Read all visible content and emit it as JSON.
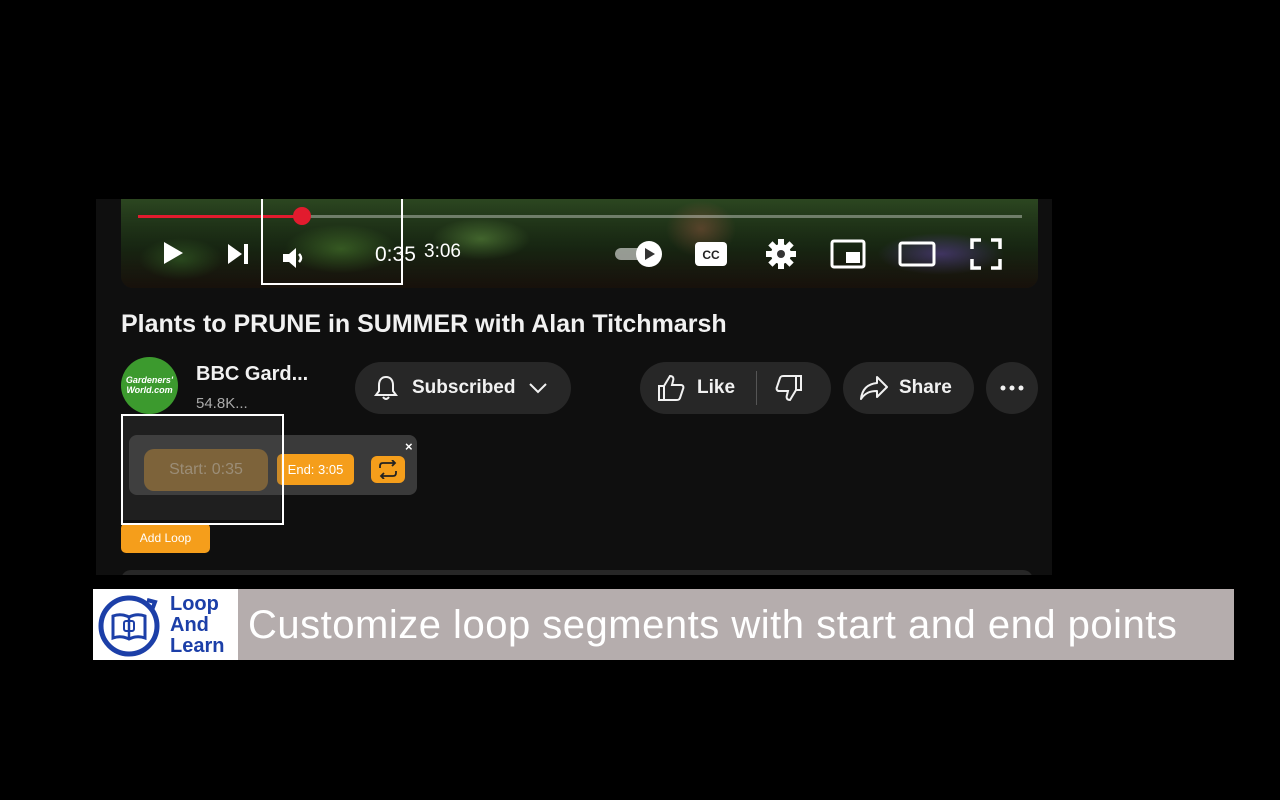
{
  "player": {
    "current_time": "0:35",
    "duration": "3:06",
    "progress_fraction": 0.185
  },
  "video": {
    "title": "Plants to PRUNE in SUMMER with Alan Titchmarsh"
  },
  "channel": {
    "avatar_text": "Gardeners' World.com",
    "name": "BBC Gard...",
    "subscribers": "54.8K..."
  },
  "actions": {
    "subscribe_label": "Subscribed",
    "like_label": "Like",
    "share_label": "Share"
  },
  "loop_widget": {
    "start_label": "Start: 0:35",
    "end_label": "End: 3:05",
    "close_label": "×",
    "add_loop_label": "Add Loop"
  },
  "banner": {
    "logo_line1": "Loop",
    "logo_line2": "And",
    "logo_line3": "Learn",
    "caption": "Customize loop segments with start and end points"
  },
  "colors": {
    "progress": "#e21b2e",
    "accent": "#f59e1b",
    "logo_blue": "#1c3fa8",
    "banner_bg": "#b5adad"
  }
}
